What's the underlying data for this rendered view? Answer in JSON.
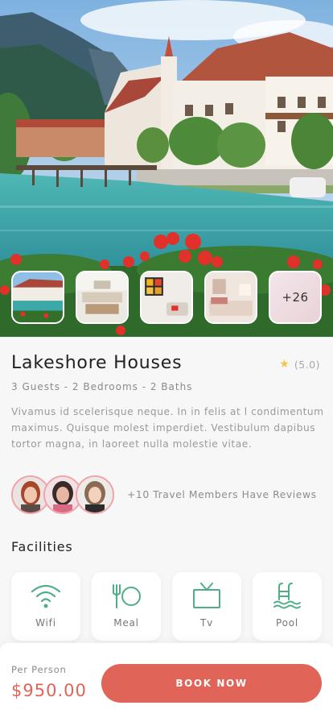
{
  "property": {
    "title": "Lakeshore Houses",
    "details": "3 Guests - 2 Bedrooms - 2 Baths",
    "rating": "(5.0)",
    "rating_stars": 5,
    "description": "Vivamus id scelerisque neque. In in felis at l condimentum maximus. Quisque molest imperdiet. Vestibulum dapibus tortor magna, in laoreet nulla molestie vitae."
  },
  "gallery": {
    "more_label": "+26"
  },
  "reviews": {
    "text": "+10 Travel Members Have Reviews"
  },
  "facilities": {
    "title": "Facilities",
    "items": [
      {
        "label": "Wifi",
        "icon": "wifi-icon"
      },
      {
        "label": "Meal",
        "icon": "meal-icon"
      },
      {
        "label": "Tv",
        "icon": "tv-icon"
      },
      {
        "label": "Pool",
        "icon": "pool-icon"
      }
    ]
  },
  "booking": {
    "per_person_label": "Per Person",
    "price": "$950.00",
    "button_label": "BOOK NOW"
  },
  "colors": {
    "accent": "#e06457",
    "icon_green": "#4fae86",
    "star": "#f6c445",
    "avatar_ring": "#f1a3a8"
  }
}
